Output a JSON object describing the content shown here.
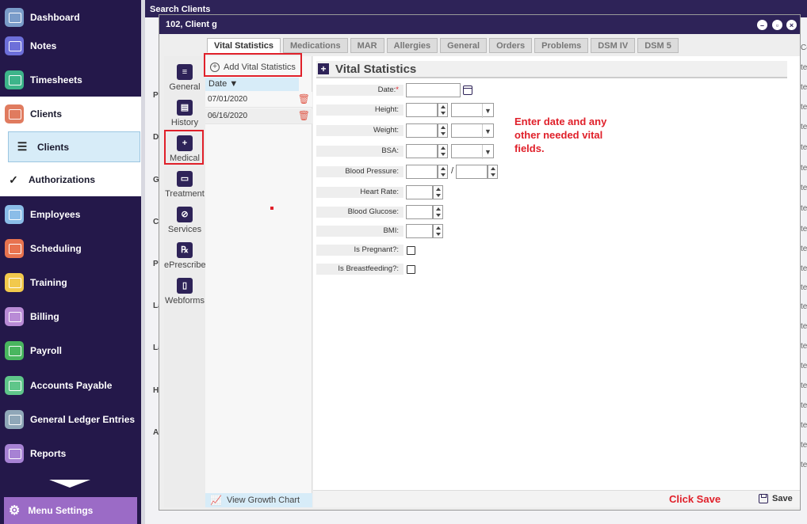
{
  "nav": {
    "items": [
      {
        "label": "Dashboard",
        "icon": "dashboard-icon",
        "color": "#7a9cc9"
      },
      {
        "label": "Notes",
        "icon": "notes-icon",
        "color": "#6d6fd9"
      },
      {
        "label": "Timesheets",
        "icon": "clock-icon",
        "color": "#3db48a"
      },
      {
        "label": "Clients",
        "icon": "folder-icon",
        "color": "#e07b5f"
      },
      {
        "label": "Employees",
        "icon": "folder-icon",
        "color": "#8bbde8"
      },
      {
        "label": "Scheduling",
        "icon": "calendar-icon",
        "color": "#e8734f"
      },
      {
        "label": "Training",
        "icon": "folder-icon",
        "color": "#f2c94c"
      },
      {
        "label": "Billing",
        "icon": "folder-icon",
        "color": "#b98bd6"
      },
      {
        "label": "Payroll",
        "icon": "folder-icon",
        "color": "#49b65f"
      },
      {
        "label": "Accounts Payable",
        "icon": "folder-icon",
        "color": "#5fc68a"
      },
      {
        "label": "General Ledger Entries",
        "icon": "document-icon",
        "color": "#8fa7b8"
      },
      {
        "label": "Reports",
        "icon": "bar-chart-icon",
        "color": "#a782d4"
      }
    ],
    "clients_sub": [
      {
        "label": "Clients",
        "icon": "client-list-icon"
      },
      {
        "label": "Authorizations",
        "icon": "checkmark-icon"
      }
    ],
    "menu_settings": "Menu Settings"
  },
  "background": {
    "header": "Search Clients",
    "labels": [
      "P",
      "D",
      "G",
      "C",
      "P",
      "La",
      "La",
      "H",
      "A"
    ],
    "right_fragments": [
      "Ce",
      "te",
      "te",
      "te",
      "te",
      "te",
      "te",
      "te",
      "te",
      "te",
      "te",
      "te",
      "te",
      "te",
      "te",
      "te",
      "te",
      "te",
      "te",
      "te",
      "te",
      "te"
    ]
  },
  "modal": {
    "title": "102, Client g",
    "tabs": [
      "Vital Statistics",
      "Medications",
      "MAR",
      "Allergies",
      "General",
      "Orders",
      "Problems",
      "DSM IV",
      "DSM 5"
    ],
    "active_tab": "Vital Statistics",
    "side": [
      {
        "label": "General",
        "icon": "general-icon",
        "glyph": "≡"
      },
      {
        "label": "History",
        "icon": "clipboard-icon",
        "glyph": "▤"
      },
      {
        "label": "Medical",
        "icon": "medical-plus-icon",
        "glyph": "+"
      },
      {
        "label": "Treatment",
        "icon": "treatment-icon",
        "glyph": "▭"
      },
      {
        "label": "Services",
        "icon": "services-icon",
        "glyph": "⊘"
      },
      {
        "label": "ePrescribe",
        "icon": "prescription-icon",
        "glyph": "℞"
      },
      {
        "label": "Webforms",
        "icon": "webform-icon",
        "glyph": "▯"
      }
    ],
    "list": {
      "add_label": "Add Vital Statistics",
      "date_header": "Date",
      "rows": [
        "07/01/2020",
        "06/16/2020"
      ],
      "growth_chart": "View Growth Chart"
    },
    "form": {
      "title": "Vital Statistics",
      "fields": {
        "date": "Date:",
        "height": "Height:",
        "weight": "Weight:",
        "bsa": "BSA:",
        "blood_pressure": "Blood Pressure:",
        "heart_rate": "Heart Rate:",
        "blood_glucose": "Blood Glucose:",
        "bmi": "BMI:",
        "is_pregnant": "Is Pregnant?:",
        "is_breastfeeding": "Is Breastfeeding?:"
      },
      "required_mark": "*",
      "bp_separator": "/"
    },
    "annotation": "Enter date and any other needed vital fields.",
    "footer": {
      "click_save": "Click Save",
      "save": "Save"
    }
  },
  "colors": {
    "nav_bg": "#24184a",
    "titlebar": "#2e2358",
    "highlight": "#e0202a",
    "selected_bg": "#d7ecf8",
    "menu_settings_bg": "#9b6bc6"
  }
}
